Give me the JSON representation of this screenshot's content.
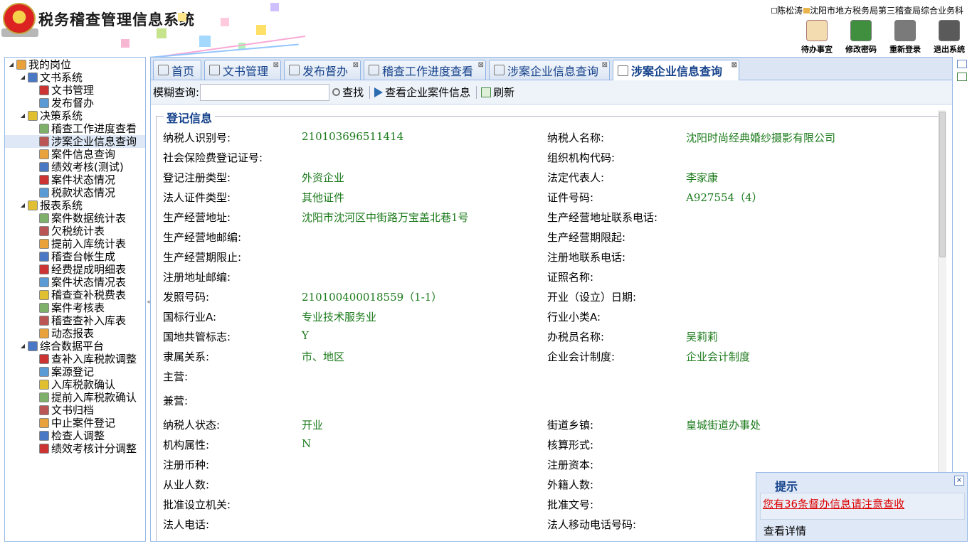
{
  "header": {
    "app_title": "税务稽查管理信息系统",
    "user_info": "陈松涛",
    "dept_info": "沈阳市地方税务局第三稽查局综合业务科",
    "tools": [
      {
        "label": "待办事宜",
        "icon": "todo-list-icon"
      },
      {
        "label": "修改密码",
        "icon": "key-icon"
      },
      {
        "label": "重新登录",
        "icon": "relogin-icon"
      },
      {
        "label": "退出系统",
        "icon": "power-icon"
      }
    ]
  },
  "sidebar": {
    "items": [
      {
        "label": "我的岗位",
        "level": 0
      },
      {
        "label": "文书系统",
        "level": 1
      },
      {
        "label": "文书管理",
        "level": 2
      },
      {
        "label": "发布督办",
        "level": 2
      },
      {
        "label": "决策系统",
        "level": 1
      },
      {
        "label": "稽查工作进度查看",
        "level": 2
      },
      {
        "label": "涉案企业信息查询",
        "level": 2,
        "selected": true
      },
      {
        "label": "案件信息查询",
        "level": 2
      },
      {
        "label": "绩效考核(测试)",
        "level": 2
      },
      {
        "label": "案件状态情况",
        "level": 2
      },
      {
        "label": "税款状态情况",
        "level": 2
      },
      {
        "label": "报表系统",
        "level": 1
      },
      {
        "label": "案件数据统计表",
        "level": 2
      },
      {
        "label": "欠税统计表",
        "level": 2
      },
      {
        "label": "提前入库统计表",
        "level": 2
      },
      {
        "label": "稽查台帐生成",
        "level": 2
      },
      {
        "label": "经费提成明细表",
        "level": 2
      },
      {
        "label": "案件状态情况表",
        "level": 2
      },
      {
        "label": "稽查查补税费表",
        "level": 2
      },
      {
        "label": "案件考核表",
        "level": 2
      },
      {
        "label": "稽查查补入库表",
        "level": 2
      },
      {
        "label": "动态报表",
        "level": 2
      },
      {
        "label": "综合数据平台",
        "level": 1
      },
      {
        "label": "查补入库税款调整",
        "level": 2
      },
      {
        "label": "案源登记",
        "level": 2
      },
      {
        "label": "入库税款确认",
        "level": 2
      },
      {
        "label": "提前入库税款确认",
        "level": 2
      },
      {
        "label": "文书归档",
        "level": 2
      },
      {
        "label": "中止案件登记",
        "level": 2
      },
      {
        "label": "检查人调整",
        "level": 2
      },
      {
        "label": "绩效考核计分调整",
        "level": 2
      }
    ]
  },
  "tabs": [
    {
      "label": "首页",
      "closable": false
    },
    {
      "label": "文书管理",
      "closable": true
    },
    {
      "label": "发布督办",
      "closable": true
    },
    {
      "label": "稽查工作进度查看",
      "closable": true
    },
    {
      "label": "涉案企业信息查询",
      "closable": true
    },
    {
      "label": "涉案企业信息查询",
      "closable": true,
      "active": true
    }
  ],
  "querybar": {
    "label": "模糊查询:",
    "input_value": "",
    "search_label": "查找",
    "view_label": "查看企业案件信息",
    "refresh_label": "刷新"
  },
  "form": {
    "legend": "登记信息",
    "rows": [
      {
        "l1": "纳税人识别号:",
        "v1": "210103696511414",
        "l2": "纳税人名称:",
        "v2": "沈阳时尚经典婚纱摄影有限公司"
      },
      {
        "l1": "社会保险费登记证号:",
        "v1": "",
        "l2": "组织机构代码:",
        "v2": ""
      },
      {
        "l1": "登记注册类型:",
        "v1": "外资企业",
        "l2": "法定代表人:",
        "v2": "李家康"
      },
      {
        "l1": "法人证件类型:",
        "v1": "其他证件",
        "l2": "证件号码:",
        "v2": "A927554（4）"
      },
      {
        "l1": "生产经营地址:",
        "v1": "沈阳市沈河区中街路万宝盖北巷1号",
        "l2": "生产经营地址联系电话:",
        "v2": ""
      },
      {
        "l1": "生产经营地邮编:",
        "v1": "",
        "l2": "生产经营期限起:",
        "v2": ""
      },
      {
        "l1": "生产经营期限止:",
        "v1": "",
        "l2": "注册地联系电话:",
        "v2": ""
      },
      {
        "l1": "注册地址邮编:",
        "v1": "",
        "l2": "证照名称:",
        "v2": ""
      },
      {
        "l1": "发照号码:",
        "v1": "210100400018559（1-1）",
        "l2": "开业（设立）日期:",
        "v2": ""
      },
      {
        "l1": "国标行业A:",
        "v1": "专业技术服务业",
        "l2": "行业小类A:",
        "v2": ""
      },
      {
        "l1": "国地共管标志:",
        "v1": "Y",
        "l2": "办税员名称:",
        "v2": "吴莉莉"
      },
      {
        "l1": "隶属关系:",
        "v1": "市、地区",
        "l2": "企业会计制度:",
        "v2": "企业会计制度"
      },
      {
        "l1": "主营:",
        "v1": "",
        "l2": "",
        "v2": ""
      },
      {
        "l1": "兼营:",
        "v1": "",
        "l2": "",
        "v2": ""
      },
      {
        "l1": "纳税人状态:",
        "v1": "开业",
        "l2": "街道乡镇:",
        "v2": "皇城街道办事处"
      },
      {
        "l1": "机构属性:",
        "v1": "N",
        "l2": "核算形式:",
        "v2": ""
      },
      {
        "l1": "注册币种:",
        "v1": "",
        "l2": "注册资本:",
        "v2": ""
      },
      {
        "l1": "从业人数:",
        "v1": "",
        "l2": "外籍人数:",
        "v2": ""
      },
      {
        "l1": "批准设立机关:",
        "v1": "",
        "l2": "批准文号:",
        "v2": ""
      },
      {
        "l1": "法人电话:",
        "v1": "",
        "l2": "法人移动电话号码:",
        "v2": ""
      }
    ]
  },
  "notice": {
    "title": "提示",
    "message": "您有36条督办信息请注意查收",
    "detail": "查看详情",
    "close": "×"
  },
  "colors": {
    "accent": "#15428b",
    "value_green": "#1b7a1b",
    "border": "#99bbe8",
    "link_red": "#dd0000"
  }
}
